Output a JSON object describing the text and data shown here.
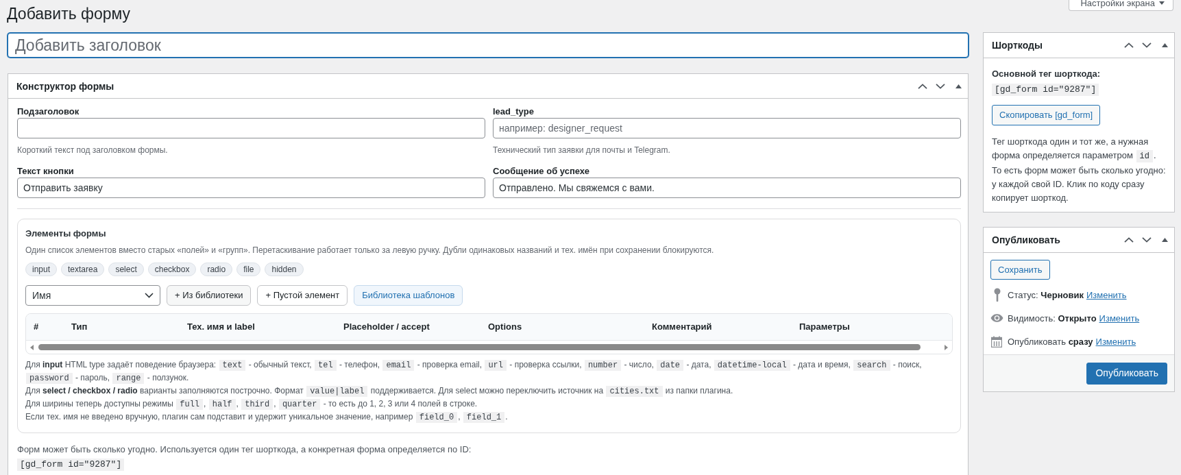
{
  "page": {
    "title": "Добавить форму",
    "screen_options_button": "Настройки экрана"
  },
  "title_field": {
    "placeholder": "Добавить заголовок"
  },
  "form_builder": {
    "title": "Конструктор формы",
    "fields": [
      {
        "label": "Подзаголовок",
        "hint": "Короткий текст под заголовком формы."
      },
      {
        "label": "lead_type",
        "placeholder": "например: designer_request",
        "hint": "Технический тип заявки для почты и Telegram."
      },
      {
        "label": "Текст кнопки",
        "value": "Отправить заявку"
      },
      {
        "label": "Сообщение об успехе",
        "value": "Отправлено. Мы свяжемся с вами."
      }
    ],
    "elements": {
      "title": "Элементы формы",
      "description": "Один список элементов вместо старых «полей» и «групп». Перетаскивание работает только за левую ручку. Дубли одинаковых названий и тех. имён при сохранении блокируются.",
      "type_chips": [
        "input",
        "textarea",
        "select",
        "checkbox",
        "radio",
        "file",
        "hidden"
      ],
      "select": {
        "value": "Имя"
      },
      "buttons": [
        {
          "label": "+ Из библиотеки",
          "kind": "secondary"
        },
        {
          "label": "+ Пустой элемент",
          "kind": "plain"
        },
        {
          "label": "Библиотека шаблонов",
          "kind": "accent"
        }
      ],
      "table": {
        "columns": [
          "#",
          "Тип",
          "Тех. имя и label",
          "Placeholder / accept",
          "Options",
          "Комментарий",
          "Параметры"
        ]
      },
      "help": [
        [
          {
            "kind": "text",
            "text": "Для **input** HTML type задаёт поведение браузера: "
          },
          {
            "kind": "code",
            "text": "text"
          },
          {
            "kind": "text",
            "text": " - обычный текст, "
          },
          {
            "kind": "code",
            "text": "tel"
          },
          {
            "kind": "text",
            "text": " - телефон, "
          },
          {
            "kind": "code",
            "text": "email"
          },
          {
            "kind": "text",
            "text": " - проверка email, "
          },
          {
            "kind": "code",
            "text": "url"
          },
          {
            "kind": "text",
            "text": " - проверка ссылки, "
          },
          {
            "kind": "code",
            "text": "number"
          },
          {
            "kind": "text",
            "text": " - число, "
          },
          {
            "kind": "code",
            "text": "date"
          },
          {
            "kind": "text",
            "text": " - дата, "
          },
          {
            "kind": "code",
            "text": "datetime-local"
          },
          {
            "kind": "text",
            "text": " - дата и время, "
          },
          {
            "kind": "code",
            "text": "search"
          },
          {
            "kind": "text",
            "text": " - поиск, "
          },
          {
            "kind": "code",
            "text": "password"
          },
          {
            "kind": "text",
            "text": " - пароль, "
          },
          {
            "kind": "code",
            "text": "range"
          },
          {
            "kind": "text",
            "text": " - ползунок."
          }
        ],
        [
          {
            "kind": "text",
            "text": "Для **select / checkbox / radio** варианты заполняются построчно. Формат "
          },
          {
            "kind": "code",
            "text": "value|label"
          },
          {
            "kind": "text",
            "text": " поддерживается. Для select можно переключить источник на "
          },
          {
            "kind": "code",
            "text": "cities.txt"
          },
          {
            "kind": "text",
            "text": " из папки плагина."
          }
        ],
        [
          {
            "kind": "text",
            "text": "Для ширины теперь доступны режимы "
          },
          {
            "kind": "code",
            "text": "full"
          },
          {
            "kind": "text",
            "text": ", "
          },
          {
            "kind": "code",
            "text": "half"
          },
          {
            "kind": "text",
            "text": ", "
          },
          {
            "kind": "code",
            "text": "third"
          },
          {
            "kind": "text",
            "text": ", "
          },
          {
            "kind": "code",
            "text": "quarter"
          },
          {
            "kind": "text",
            "text": " - то есть до 1, 2, 3 или 4 полей в строке."
          }
        ],
        [
          {
            "kind": "text",
            "text": "Если тех. имя не введено вручную, плагин сам подставит и удержит уникальное значение, например "
          },
          {
            "kind": "code",
            "text": "field_0"
          },
          {
            "kind": "text",
            "text": ", "
          },
          {
            "kind": "code",
            "text": "field_1"
          },
          {
            "kind": "text",
            "text": "."
          }
        ]
      ]
    },
    "note": {
      "text": "Форм может быть сколько угодно. Используется один тег шорткода, а конкретная форма определяется по ID:",
      "code": "[gd_form id=\"9287\"]"
    }
  },
  "sidebar": {
    "shortcodes": {
      "title": "Шорткоды",
      "label": "Основной тег шорткода:",
      "code": "[gd_form id=\"9287\"]",
      "copy_button": "Скопировать [gd_form]",
      "description": [
        {
          "kind": "text",
          "text": "Тег шорткода один и тот же, а нужная форма определяется параметром "
        },
        {
          "kind": "code",
          "text": "id"
        },
        {
          "kind": "text",
          "text": ". То есть форм может быть сколько угодно: у каждой свой ID. Клик по коду сразу копирует шорткод."
        }
      ]
    },
    "publish": {
      "title": "Опубликовать",
      "save_button": "Сохранить",
      "rows": [
        {
          "kind": "status",
          "label": "Статус: **Черновик**",
          "link": "Изменить"
        },
        {
          "kind": "visibility",
          "label": "Видимость: **Открыто**",
          "link": "Изменить"
        },
        {
          "kind": "schedule",
          "label": "Опубликовать **сразу**",
          "link": "Изменить"
        }
      ],
      "publish_button": "Опубликовать"
    }
  }
}
